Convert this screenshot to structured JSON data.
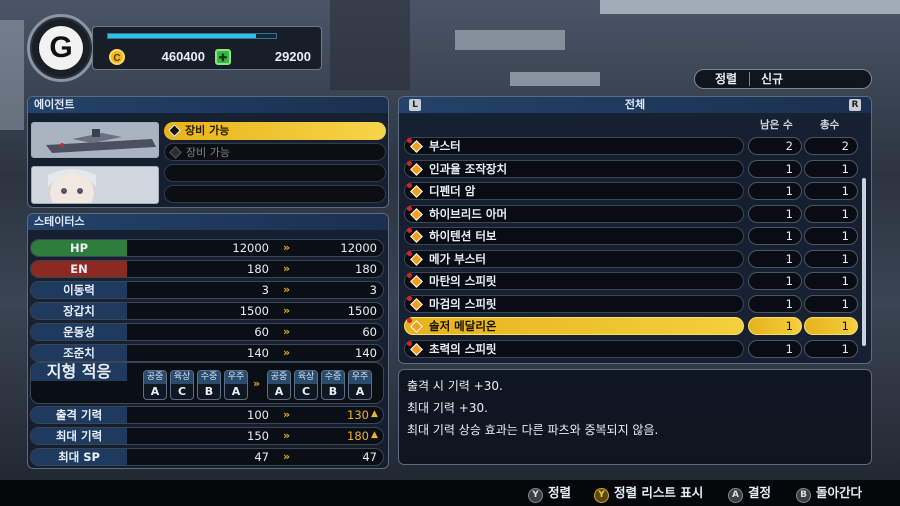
{
  "currency": {
    "credits": "460400",
    "parts_points": "29200"
  },
  "sort": {
    "label": "정렬",
    "value": "신규"
  },
  "agent": {
    "title": "에이전트",
    "slots": [
      {
        "label": "장비 가능",
        "state": "selected"
      },
      {
        "label": "장비 가능",
        "state": "dim"
      },
      {
        "label": "",
        "state": "empty"
      },
      {
        "label": "",
        "state": "empty"
      }
    ]
  },
  "status": {
    "title": "스테이터스",
    "rows": [
      {
        "label": "HP",
        "current": "12000",
        "next": "12000",
        "color": "#2e7d3c"
      },
      {
        "label": "EN",
        "current": "180",
        "next": "180",
        "color": "#8c2a22"
      },
      {
        "label": "이동력",
        "current": "3",
        "next": "3",
        "color": "#1f3a5f"
      },
      {
        "label": "장갑치",
        "current": "1500",
        "next": "1500",
        "color": "#1f3a5f"
      },
      {
        "label": "운동성",
        "current": "60",
        "next": "60",
        "color": "#1f3a5f"
      },
      {
        "label": "조준치",
        "current": "140",
        "next": "140",
        "color": "#1f3a5f"
      }
    ],
    "terrain": {
      "label": "지형 적응",
      "current": [
        {
          "t": "공중",
          "g": "A"
        },
        {
          "t": "육상",
          "g": "C"
        },
        {
          "t": "수중",
          "g": "B"
        },
        {
          "t": "우주",
          "g": "A"
        }
      ],
      "next": [
        {
          "t": "공중",
          "g": "A"
        },
        {
          "t": "육상",
          "g": "C"
        },
        {
          "t": "수중",
          "g": "B"
        },
        {
          "t": "우주",
          "g": "A"
        }
      ]
    },
    "rows2": [
      {
        "label": "출격 기력",
        "current": "100",
        "next": "130",
        "up": true
      },
      {
        "label": "최대 기력",
        "current": "150",
        "next": "180",
        "up": true
      },
      {
        "label": "최대 SP",
        "current": "47",
        "next": "47",
        "up": false
      }
    ]
  },
  "list": {
    "tab_left": "L",
    "tab_title": "전체",
    "tab_right": "R",
    "col_remaining": "남은 수",
    "col_total": "총수",
    "items": [
      {
        "name": "부스터",
        "remaining": "2",
        "total": "2"
      },
      {
        "name": "인과율 조작장치",
        "remaining": "1",
        "total": "1"
      },
      {
        "name": "디펜더 암",
        "remaining": "1",
        "total": "1"
      },
      {
        "name": "하이브리드 아머",
        "remaining": "1",
        "total": "1"
      },
      {
        "name": "하이텐션 터보",
        "remaining": "1",
        "total": "1"
      },
      {
        "name": "메가 부스터",
        "remaining": "1",
        "total": "1"
      },
      {
        "name": "마탄의 스피릿",
        "remaining": "1",
        "total": "1"
      },
      {
        "name": "마검의 스피릿",
        "remaining": "1",
        "total": "1"
      },
      {
        "name": "솔저 메달리온",
        "remaining": "1",
        "total": "1"
      },
      {
        "name": "초력의 스피릿",
        "remaining": "1",
        "total": "1"
      }
    ],
    "selected_index": 8
  },
  "description": {
    "lines": [
      "출격 시 기력 +30.",
      "최대 기력 +30.",
      "최대 기력 상승 효과는 다른 파츠와 중복되지 않음."
    ]
  },
  "controls": [
    {
      "key": "Y",
      "label": "정렬"
    },
    {
      "key": "Y",
      "label": "정렬 리스트 표시"
    },
    {
      "key": "A",
      "label": "결정"
    },
    {
      "key": "B",
      "label": "돌아간다"
    }
  ]
}
